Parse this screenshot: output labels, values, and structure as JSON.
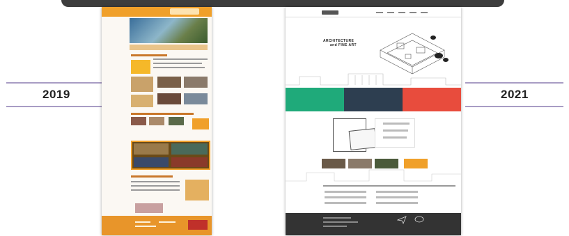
{
  "timeline": {
    "left_year": "2019",
    "right_year": "2021"
  },
  "mockup_2021": {
    "headline_line1": "ARCHITECTURE",
    "headline_line2": "and FINE ART"
  },
  "colors": {
    "topbar": "#3d3d3d",
    "timeline_line": "#a89cc4",
    "orange_2019": "#f0a02a",
    "green_band": "#1faa7a",
    "navy_band": "#2d3e50",
    "red_band": "#e84c3d",
    "footer_2021": "#333333"
  }
}
